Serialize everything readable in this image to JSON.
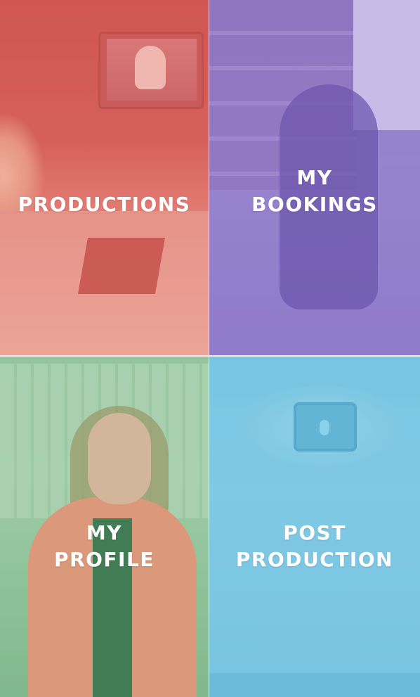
{
  "tiles": [
    {
      "id": "productions",
      "label_lines": [
        "PRODUCTIONS"
      ],
      "tint_color": "#e4685f"
    },
    {
      "id": "my-bookings",
      "label_lines": [
        "MY",
        "BOOKINGS"
      ],
      "tint_color": "#967dd2"
    },
    {
      "id": "my-profile",
      "label_lines": [
        "MY",
        "PROFILE"
      ],
      "tint_color": "#8cc896"
    },
    {
      "id": "post-production",
      "label_lines": [
        "POST",
        "PRODUCTION"
      ],
      "tint_color": "#6ec3e1"
    }
  ]
}
